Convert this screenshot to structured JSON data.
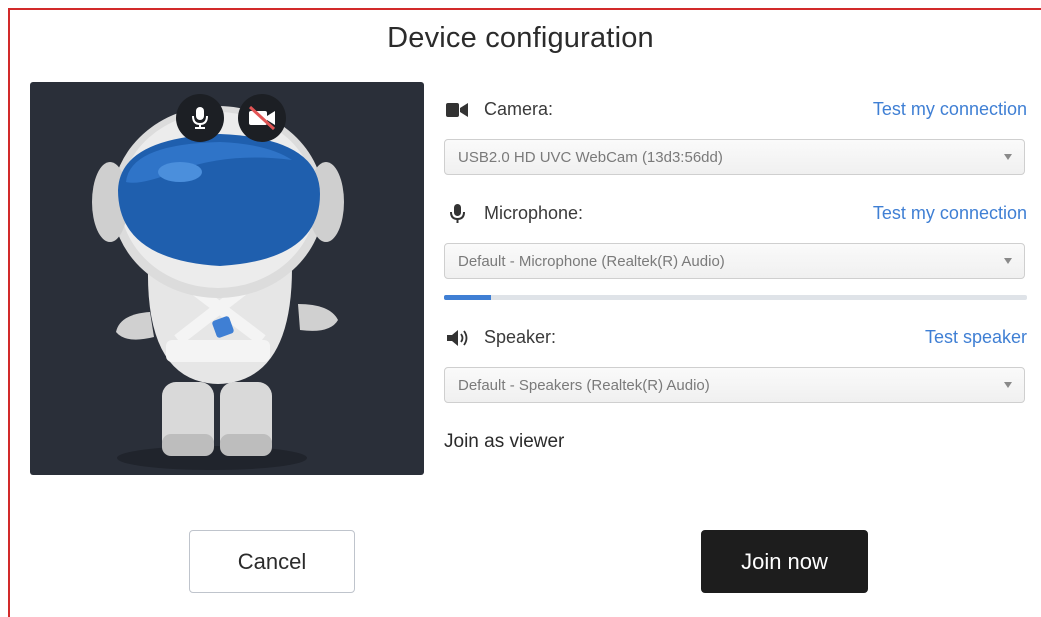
{
  "dialog": {
    "title": "Device configuration"
  },
  "preview": {
    "mic_button_icon": "microphone-icon",
    "camera_button_icon": "camera-off-icon",
    "avatar": "astronaut-avatar"
  },
  "camera": {
    "label": "Camera:",
    "icon": "video-camera-icon",
    "link": "Test my connection",
    "selected": "USB2.0 HD UVC WebCam (13d3:56dd)"
  },
  "microphone": {
    "label": "Microphone:",
    "icon": "microphone-icon",
    "link": "Test my connection",
    "selected": "Default - Microphone (Realtek(R) Audio)",
    "level": 0.08
  },
  "speaker": {
    "label": "Speaker:",
    "icon": "speaker-icon",
    "link": "Test speaker",
    "selected": "Default - Speakers (Realtek(R) Audio)"
  },
  "join_as_viewer": "Join as viewer",
  "buttons": {
    "cancel": "Cancel",
    "join": "Join now"
  },
  "colors": {
    "accent": "#3f7fd4",
    "primary_button": "#1d1d1d",
    "preview_bg": "#2a2f39",
    "frame": "#d22a2a"
  }
}
